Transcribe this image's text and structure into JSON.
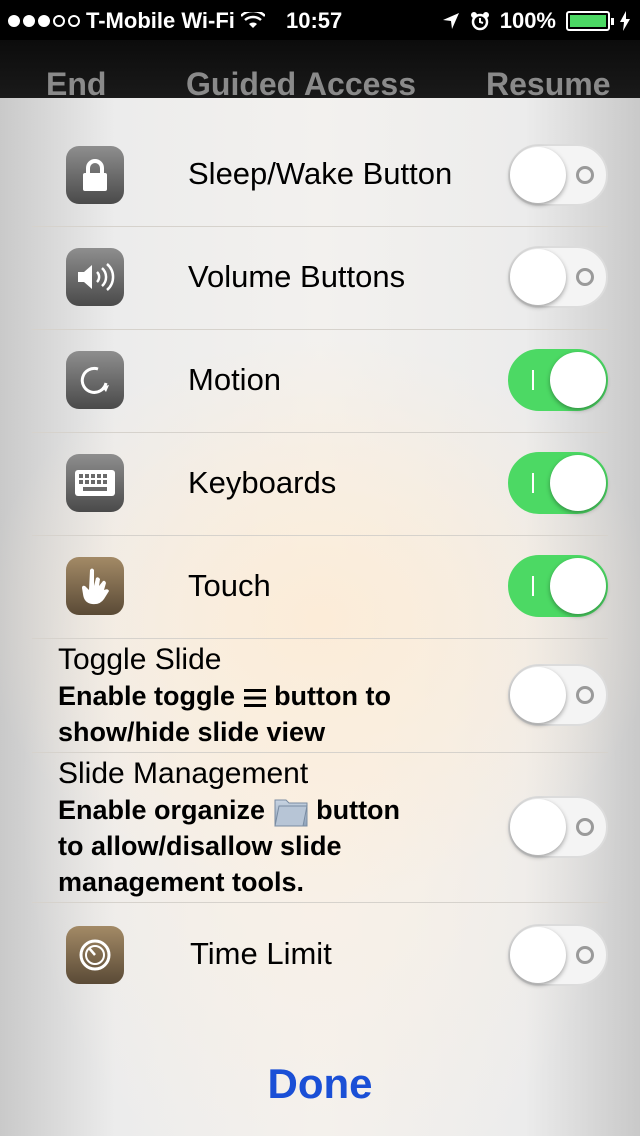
{
  "status": {
    "carrier": "T-Mobile Wi-Fi",
    "time": "10:57",
    "battery": "100%"
  },
  "nav": {
    "end_label": "End",
    "title": "Guided Access",
    "resume_label": "Resume"
  },
  "options": [
    {
      "label": "Sleep/Wake Button",
      "icon": "lock-icon",
      "enabled": false
    },
    {
      "label": "Volume Buttons",
      "icon": "speaker-icon",
      "enabled": false
    },
    {
      "label": "Motion",
      "icon": "rotate-icon",
      "enabled": true
    },
    {
      "label": "Keyboards",
      "icon": "keyboard-icon",
      "enabled": true
    },
    {
      "label": "Touch",
      "icon": "hand-pointer-icon",
      "enabled": true
    }
  ],
  "toggle_slide": {
    "title": "Toggle Slide",
    "sub_line1_before": "Enable toggle",
    "sub_line1_after": "button to",
    "sub_line2": "show/hide slide view",
    "inline_icon": "hamburger-menu-icon",
    "enabled": false
  },
  "slide_management": {
    "title": "Slide Management",
    "sub_line1_before": "Enable organize",
    "sub_line1_after": "button",
    "sub_line2": "to allow/disallow slide",
    "sub_line3": "management tools.",
    "inline_icon": "folder-icon",
    "enabled": false
  },
  "time_limit": {
    "label": "Time Limit",
    "icon": "timer-icon",
    "enabled": false
  },
  "done_label": "Done",
  "colors": {
    "switch_on": "#4cd964",
    "done": "#1a4fd6"
  }
}
